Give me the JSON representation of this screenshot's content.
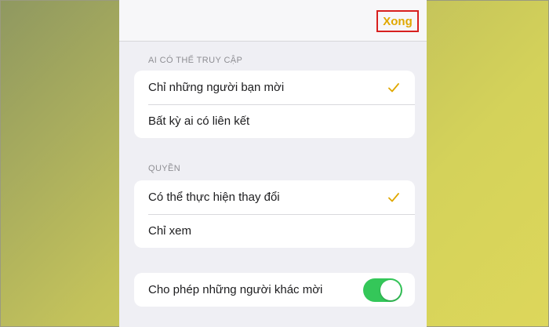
{
  "nav": {
    "done_label": "Xong"
  },
  "access": {
    "header": "AI CÓ THỂ TRUY CẬP",
    "options": [
      {
        "label": "Chỉ những người bạn mời",
        "selected": true
      },
      {
        "label": "Bất kỳ ai có liên kết",
        "selected": false
      }
    ]
  },
  "permissions": {
    "header": "QUYỀN",
    "options": [
      {
        "label": "Có thể thực hiện thay đổi",
        "selected": true
      },
      {
        "label": "Chỉ xem",
        "selected": false
      }
    ]
  },
  "invite": {
    "label": "Cho phép những người khác mời",
    "enabled": true
  },
  "colors": {
    "accent": "#e0a800",
    "toggle_on": "#34c759",
    "highlight_box": "#d8201f"
  }
}
